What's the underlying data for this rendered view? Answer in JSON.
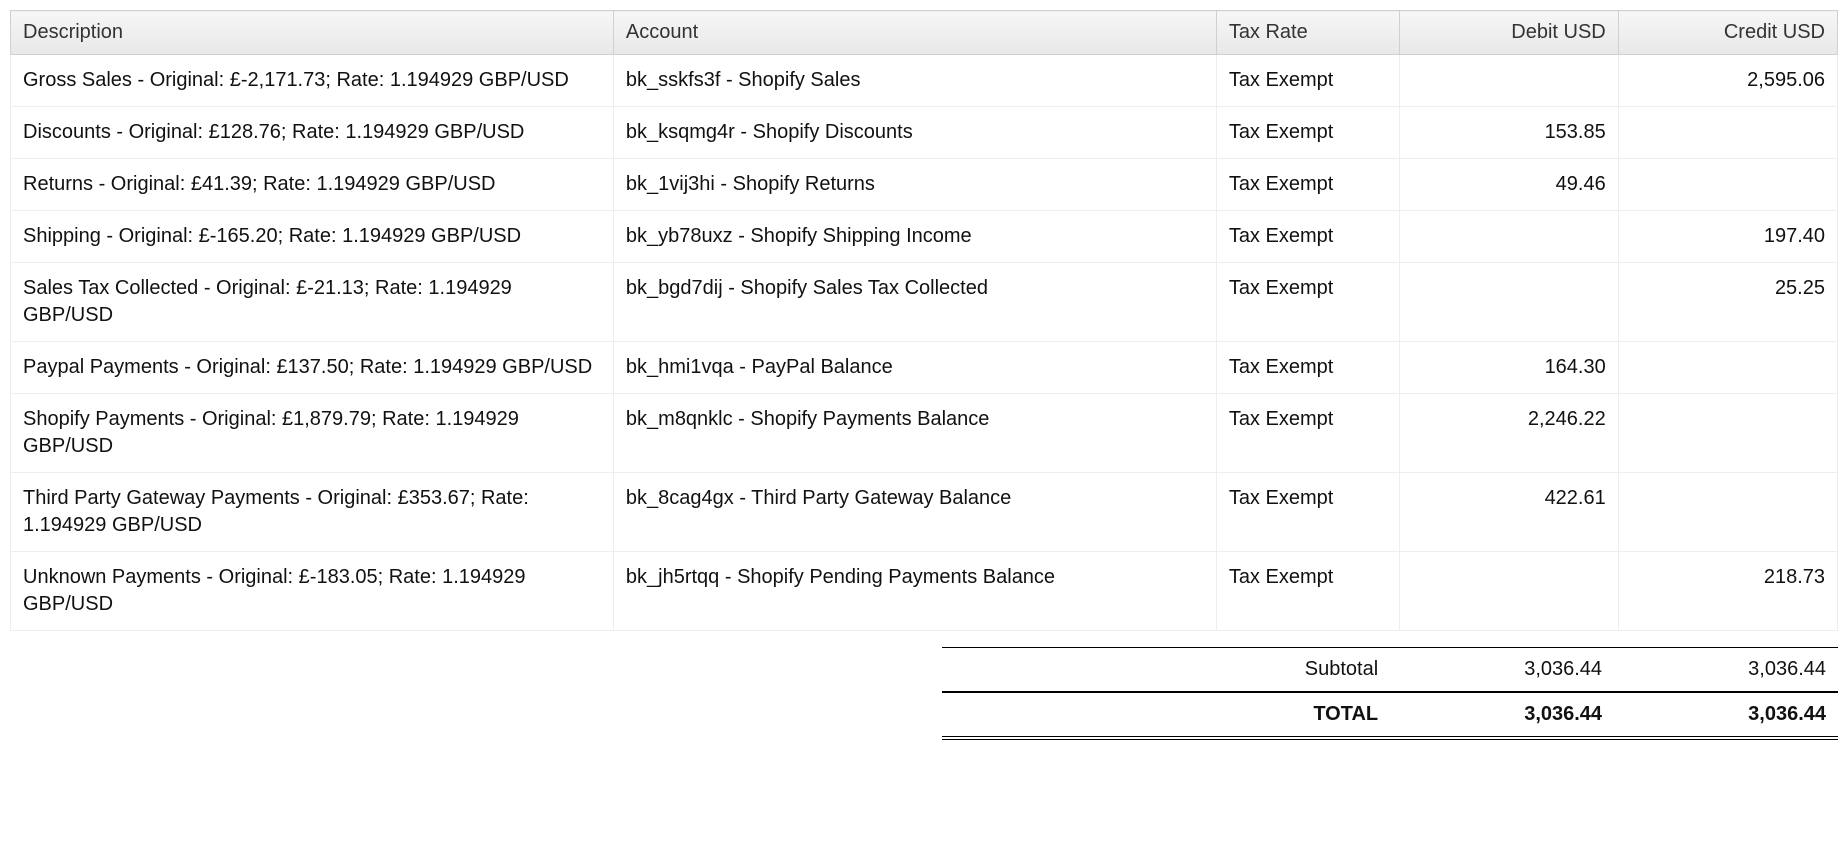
{
  "headers": {
    "description": "Description",
    "account": "Account",
    "tax_rate": "Tax Rate",
    "debit": "Debit USD",
    "credit": "Credit USD"
  },
  "rows": [
    {
      "description": "Gross Sales - Original: £-2,171.73; Rate: 1.194929 GBP/USD",
      "account": "bk_sskfs3f - Shopify Sales",
      "tax_rate": "Tax Exempt",
      "debit": "",
      "credit": "2,595.06"
    },
    {
      "description": "Discounts - Original: £128.76; Rate: 1.194929 GBP/USD",
      "account": "bk_ksqmg4r - Shopify Discounts",
      "tax_rate": "Tax Exempt",
      "debit": "153.85",
      "credit": ""
    },
    {
      "description": "Returns - Original: £41.39; Rate: 1.194929 GBP/USD",
      "account": "bk_1vij3hi - Shopify Returns",
      "tax_rate": "Tax Exempt",
      "debit": "49.46",
      "credit": ""
    },
    {
      "description": "Shipping - Original: £-165.20; Rate: 1.194929 GBP/USD",
      "account": "bk_yb78uxz - Shopify Shipping Income",
      "tax_rate": "Tax Exempt",
      "debit": "",
      "credit": "197.40"
    },
    {
      "description": "Sales Tax Collected - Original: £-21.13; Rate: 1.194929 GBP/USD",
      "account": "bk_bgd7dij - Shopify Sales Tax Collected",
      "tax_rate": "Tax Exempt",
      "debit": "",
      "credit": "25.25"
    },
    {
      "description": "Paypal Payments - Original: £137.50; Rate: 1.194929 GBP/USD",
      "account": "bk_hmi1vqa - PayPal Balance",
      "tax_rate": "Tax Exempt",
      "debit": "164.30",
      "credit": ""
    },
    {
      "description": "Shopify Payments - Original: £1,879.79; Rate: 1.194929 GBP/USD",
      "account": "bk_m8qnklc - Shopify Payments Balance",
      "tax_rate": "Tax Exempt",
      "debit": "2,246.22",
      "credit": ""
    },
    {
      "description": "Third Party Gateway Payments - Original: £353.67; Rate: 1.194929 GBP/USD",
      "account": "bk_8cag4gx - Third Party Gateway Balance",
      "tax_rate": "Tax Exempt",
      "debit": "422.61",
      "credit": ""
    },
    {
      "description": "Unknown Payments - Original: £-183.05; Rate: 1.194929 GBP/USD",
      "account": "bk_jh5rtqq - Shopify Pending Payments Balance",
      "tax_rate": "Tax Exempt",
      "debit": "",
      "credit": "218.73"
    }
  ],
  "totals": {
    "subtotal_label": "Subtotal",
    "subtotal_debit": "3,036.44",
    "subtotal_credit": "3,036.44",
    "total_label": "TOTAL",
    "total_debit": "3,036.44",
    "total_credit": "3,036.44"
  }
}
